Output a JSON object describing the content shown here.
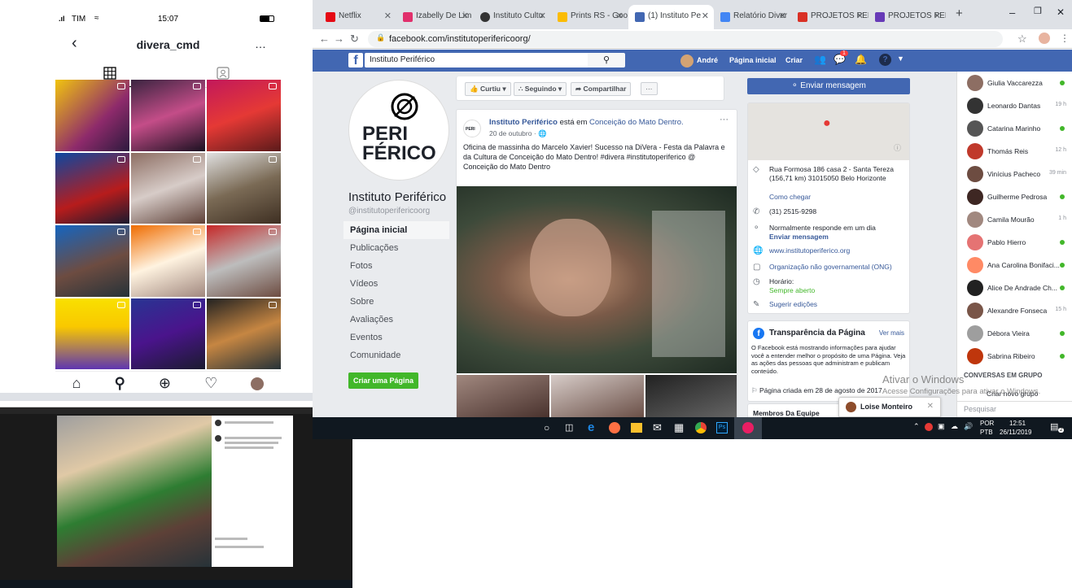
{
  "phone": {
    "carrier": "TIM",
    "time": "15:07",
    "username": "divera_cmd",
    "more_icon": "…"
  },
  "browser": {
    "tabs": [
      {
        "label": "Netflix",
        "color": "#e50914"
      },
      {
        "label": "Izabelly De Lim",
        "color": "#e1306c"
      },
      {
        "label": "Instituto Cultu",
        "color": "#333333"
      },
      {
        "label": "Prints RS - Goo",
        "color": "#fbbc04"
      },
      {
        "label": "(1) Instituto Pe",
        "color": "#4267b2"
      },
      {
        "label": "Relatório Diver",
        "color": "#4285f4"
      },
      {
        "label": "PROJETOS PER",
        "color": "#d93025"
      },
      {
        "label": "PROJETOS PER",
        "color": "#673ab7"
      }
    ],
    "url": "facebook.com/institutoperifericoorg/"
  },
  "facebook": {
    "search_value": "Instituto Periférico",
    "user_name": "André",
    "nav_home": "Página inicial",
    "nav_create": "Criar",
    "notif_count": "1",
    "page_logo_line1": "PERI",
    "page_logo_line2": "FÉRICO",
    "page_name": "Instituto Periférico",
    "page_handle": "@institutoperifericoorg",
    "side_menu": [
      "Página inicial",
      "Publicações",
      "Fotos",
      "Vídeos",
      "Sobre",
      "Avaliações",
      "Eventos",
      "Comunidade"
    ],
    "create_page": "Criar uma Página",
    "actions": {
      "like": "Curtiu",
      "follow": "Seguindo",
      "share": "Compartilhar",
      "more": "···"
    },
    "post": {
      "author": "Instituto Periférico",
      "location_prefix": "está em",
      "location": "Conceição do Mato Dentro.",
      "date": "20 de outubro",
      "text": "Oficina de massinha do Marcelo Xavier! Sucesso na DiVera - Festa da Palavra e da Cultura de Conceição do Mato Dentro! #divera #institutoperiferico @ Conceição do Mato Dentro",
      "more": "···"
    },
    "send_message": "Enviar mensagem",
    "info": {
      "address": "Rua Formosa 186 casa 2 - Santa Tereza (156,71 km) 31015050 Belo Horizonte",
      "directions": "Como chegar",
      "phone": "(31) 2515-9298",
      "response": "Normalmente responde em um dia",
      "send": "Enviar mensagem",
      "website": "www.institutoperiferico.org",
      "category": "Organização não governamental (ONG)",
      "hours_label": "Horário:",
      "hours": "Sempre aberto",
      "suggest": "Sugerir edições"
    },
    "transparency": {
      "title": "Transparência da Página",
      "see_more": "Ver mais",
      "text": "O Facebook está mostrando informações para ajudar você a entender melhor o propósito de uma Página. Veja as ações das pessoas que administram e publicam conteúdo.",
      "created": "Página criada em 28 de agosto de 2017"
    },
    "team": "Membros Da Equipe",
    "chat_popup": "Loise Monteiro",
    "contacts": [
      {
        "name": "Giulia Vaccarezza",
        "status": "online",
        "color": "#8d6e63"
      },
      {
        "name": "Leonardo Dantas",
        "status": "19 h",
        "color": "#333333"
      },
      {
        "name": "Catarina Marinho",
        "status": "online",
        "color": "#555555"
      },
      {
        "name": "Thomás Reis",
        "status": "12 h",
        "color": "#c0392b"
      },
      {
        "name": "Vinícius Pacheco",
        "status": "39 min",
        "color": "#6d4c41"
      },
      {
        "name": "Guilherme Pedrosa",
        "status": "online",
        "color": "#3e2723"
      },
      {
        "name": "Camila Mourão",
        "status": "1 h",
        "color": "#a1887f"
      },
      {
        "name": "Pablo Hierro",
        "status": "online",
        "color": "#e57373"
      },
      {
        "name": "Ana Carolina Bonifaci...",
        "status": "online",
        "color": "#ff8a65"
      },
      {
        "name": "Alice De Andrade Ch...",
        "status": "online",
        "color": "#212121"
      },
      {
        "name": "Alexandre Fonseca",
        "status": "15 h",
        "color": "#795548"
      },
      {
        "name": "Débora Vieira",
        "status": "online",
        "color": "#9e9e9e"
      },
      {
        "name": "Sabrina Ribeiro",
        "status": "online",
        "color": "#bf360c"
      }
    ],
    "groups_header": "CONVERSAS EM GRUPO",
    "new_group": "Criar novo grupo",
    "chat_search": "Pesquisar"
  },
  "windows": {
    "activate_line1": "Ativar o Windows",
    "activate_line2": "Acesse Configurações para ativar o Windows.",
    "lang1": "POR",
    "lang2": "PTB",
    "time": "12:51",
    "date": "26/11/2019",
    "notif": "2"
  }
}
